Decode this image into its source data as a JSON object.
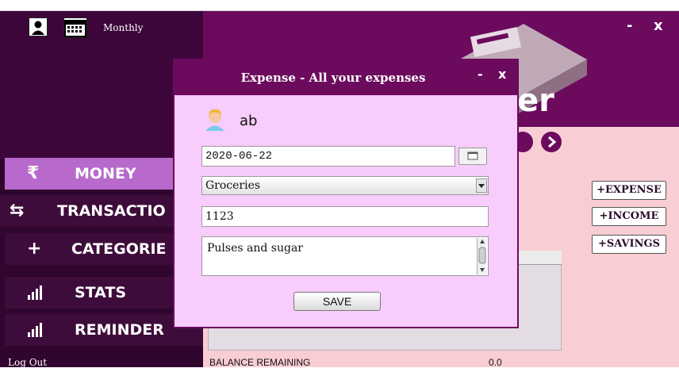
{
  "app": {
    "period_label": "Monthly",
    "minimize": "-",
    "close": "x",
    "brand_partial": "er",
    "nav": [
      {
        "label": "MONEY",
        "icon": "₹"
      },
      {
        "label": "TRANSACTIO",
        "icon": "⇆"
      },
      {
        "label": "CATEGORIE",
        "icon": "+"
      },
      {
        "label": "STATS",
        "icon": "📶"
      },
      {
        "label": "REMINDER",
        "icon": "📶"
      }
    ],
    "logout": "Log Out",
    "buttons": {
      "expense": "+EXPENSE",
      "income": "+INCOME",
      "savings": "+SAVINGS"
    },
    "balance_label": "BALANCE REMAINING",
    "balance_value": "0.0",
    "colors": {
      "sidebar": "#30052e",
      "header": "#6c0a5e",
      "content": "#f9cdd4",
      "active_nav": "#b76acb",
      "dialog": "#f8ccfc"
    }
  },
  "dialog": {
    "title": "Expense - All your expenses",
    "minimize": "-",
    "close": "x",
    "user_name": "ab",
    "date_value": "2020-06-22",
    "category_value": "Groceries",
    "amount_value": "1123",
    "note_value": "Pulses and sugar",
    "save_label": "SAVE"
  }
}
